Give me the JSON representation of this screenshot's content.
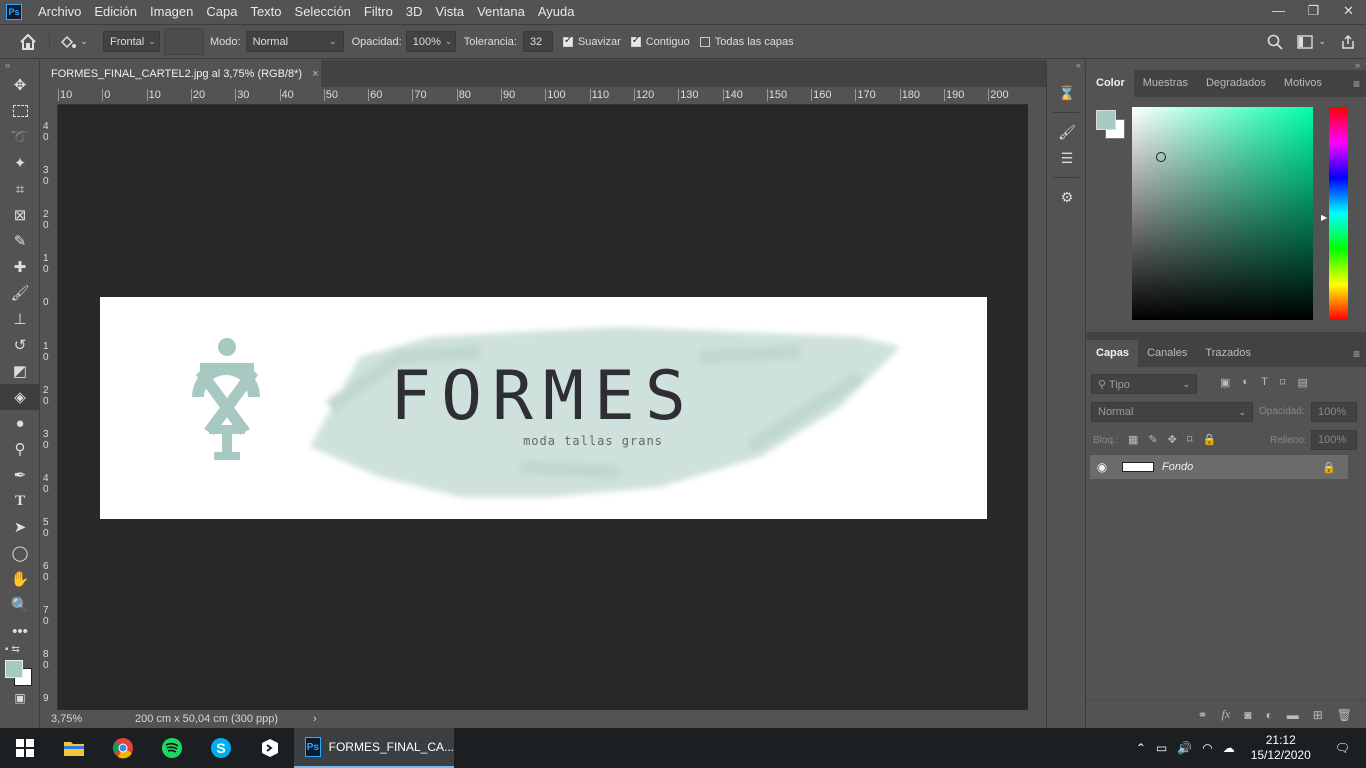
{
  "app": {
    "icon_label": "Ps"
  },
  "menu": [
    "Archivo",
    "Edición",
    "Imagen",
    "Capa",
    "Texto",
    "Selección",
    "Filtro",
    "3D",
    "Vista",
    "Ventana",
    "Ayuda"
  ],
  "window_controls": [
    "—",
    "❐",
    "✕"
  ],
  "options": {
    "fill_source": "Frontal",
    "mode_label": "Modo:",
    "mode_value": "Normal",
    "opacity_label": "Opacidad:",
    "opacity_value": "100%",
    "tolerance_label": "Tolerancia:",
    "tolerance_value": "32",
    "smooth_label": "Suavizar",
    "contiguous_label": "Contiguo",
    "all_layers_label": "Todas las capas"
  },
  "document": {
    "tab_title": "FORMES_FINAL_CARTEL2.jpg al 3,75% (RGB/8*)",
    "close": "×",
    "zoom": "3,75%",
    "size_info": "200 cm x 50,04 cm (300 ppp)",
    "logo_text": "FORMES",
    "tagline": "moda tallas grans"
  },
  "rulers": {
    "h_ticks": [
      "10",
      "0",
      "10",
      "20",
      "30",
      "40",
      "50",
      "60",
      "70",
      "80",
      "90",
      "100",
      "110",
      "120",
      "130",
      "140",
      "150",
      "160",
      "170",
      "180",
      "190",
      "200"
    ],
    "v_ticks": [
      "4 0",
      "3 0",
      "2 0",
      "1 0",
      "0",
      "1 0",
      "2 0",
      "3 0",
      "4 0",
      "5 0",
      "6 0",
      "7 0",
      "8 0",
      "9"
    ]
  },
  "color_panel": {
    "tabs": [
      "Color",
      "Muestras",
      "Degradados",
      "Motivos"
    ],
    "foreground": "#a8c9c1",
    "background": "#ffffff",
    "hue": "#00ffa8"
  },
  "layers_panel": {
    "tabs": [
      "Capas",
      "Canales",
      "Trazados"
    ],
    "filter_placeholder": "Tipo",
    "blend_mode": "Normal",
    "opacity_label": "Opacidad:",
    "opacity_value": "100%",
    "lock_label": "Bloq.:",
    "fill_label": "Relleno:",
    "fill_value": "100%",
    "layers": [
      {
        "name": "Fondo",
        "visible": true,
        "locked": true
      }
    ],
    "bottom_icons": [
      "link",
      "fx",
      "mask",
      "adjust",
      "folder",
      "new",
      "trash"
    ]
  },
  "taskbar": {
    "apps": [
      "windows",
      "explorer",
      "chrome",
      "spotify",
      "skype",
      "dev"
    ],
    "active_label": "FORMES_FINAL_CA...",
    "time": "21:12",
    "date": "15/12/2020"
  },
  "colors": {
    "accent": "#31a8ff",
    "ui": "#535353",
    "canvas": "#282828",
    "brand_teal": "#a8c9c1"
  }
}
